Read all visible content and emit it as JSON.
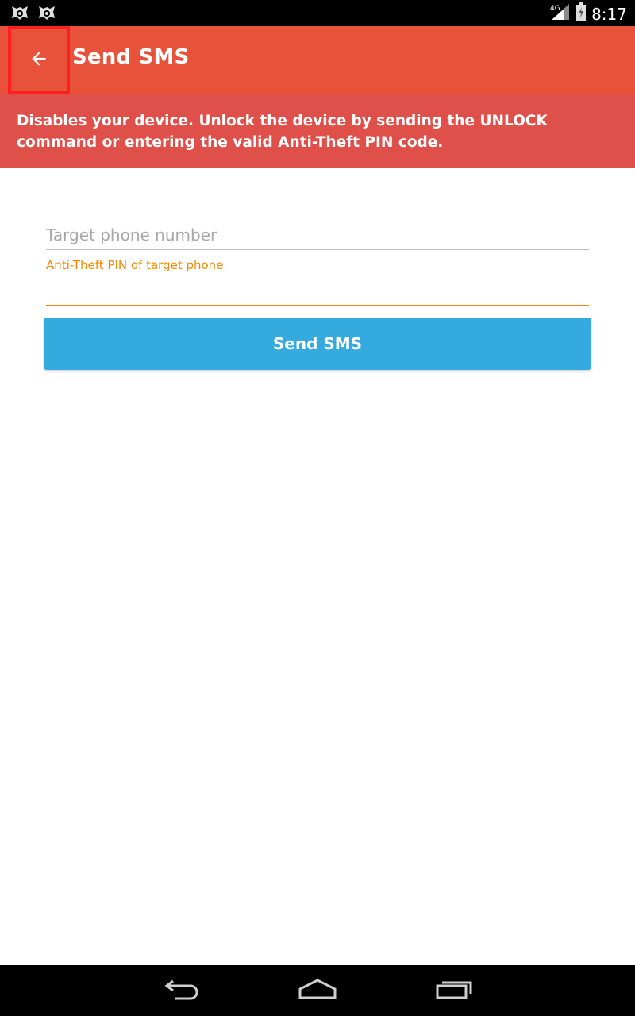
{
  "status_bar": {
    "network": "4G",
    "time": "8:17",
    "notification_icons": [
      "app-notification-icon",
      "app-notification-icon"
    ]
  },
  "app_bar": {
    "back_icon": "arrow-back-icon",
    "title": "Send SMS"
  },
  "banner": {
    "text": "Disables your device. Unlock the device by sending the UNLOCK command or entering the valid Anti-Theft PIN code."
  },
  "form": {
    "phone": {
      "placeholder": "Target phone number",
      "value": ""
    },
    "pin": {
      "label": "Anti-Theft PIN of target phone",
      "value": ""
    },
    "submit_label": "Send SMS"
  },
  "nav_bar": {
    "icons": [
      "back-nav-icon",
      "home-nav-icon",
      "recent-apps-icon"
    ]
  },
  "colors": {
    "app_bar": "#e8513a",
    "banner": "#e0504a",
    "accent_orange": "#f5841f",
    "button_blue": "#34aadf"
  }
}
